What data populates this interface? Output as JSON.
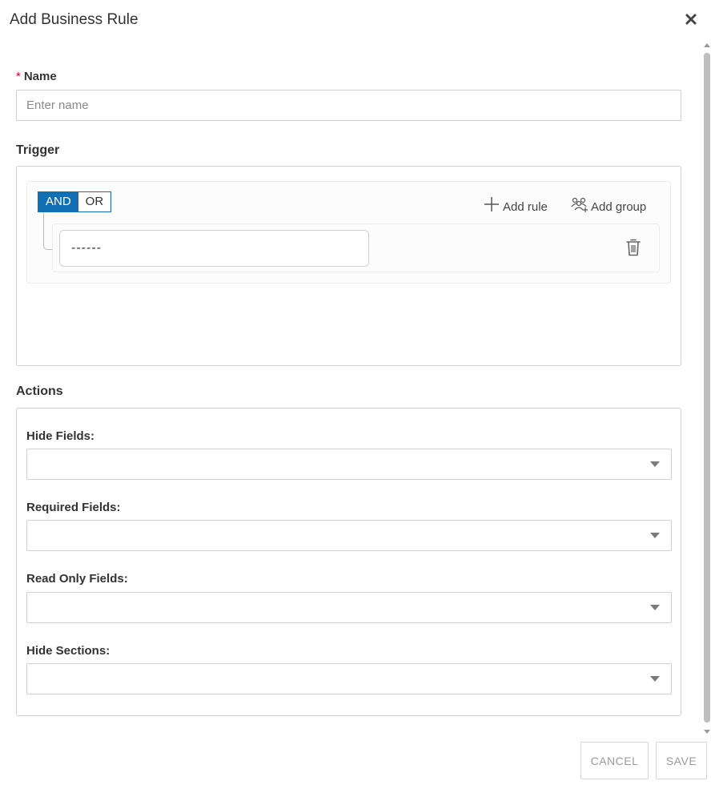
{
  "dialog": {
    "title": "Add Business Rule"
  },
  "name_field": {
    "label": "Name",
    "required_mark": "*",
    "placeholder": "Enter name",
    "value": ""
  },
  "trigger": {
    "heading": "Trigger",
    "combinator": {
      "and_label": "AND",
      "or_label": "OR",
      "active": "AND"
    },
    "add_rule_label": "Add rule",
    "add_group_label": "Add group",
    "rule": {
      "field_value": "------"
    }
  },
  "actions": {
    "heading": "Actions",
    "fields": [
      {
        "label": "Hide Fields:",
        "value": ""
      },
      {
        "label": "Required Fields:",
        "value": ""
      },
      {
        "label": "Read Only Fields:",
        "value": ""
      },
      {
        "label": "Hide Sections:",
        "value": ""
      }
    ]
  },
  "footer": {
    "cancel_label": "CANCEL",
    "save_label": "SAVE"
  },
  "colors": {
    "accent": "#0f6fb2",
    "required": "#d9001b"
  },
  "icons": [
    "close-icon",
    "plus-icon",
    "add-group-icon",
    "trash-icon",
    "chevron-down-icon"
  ]
}
